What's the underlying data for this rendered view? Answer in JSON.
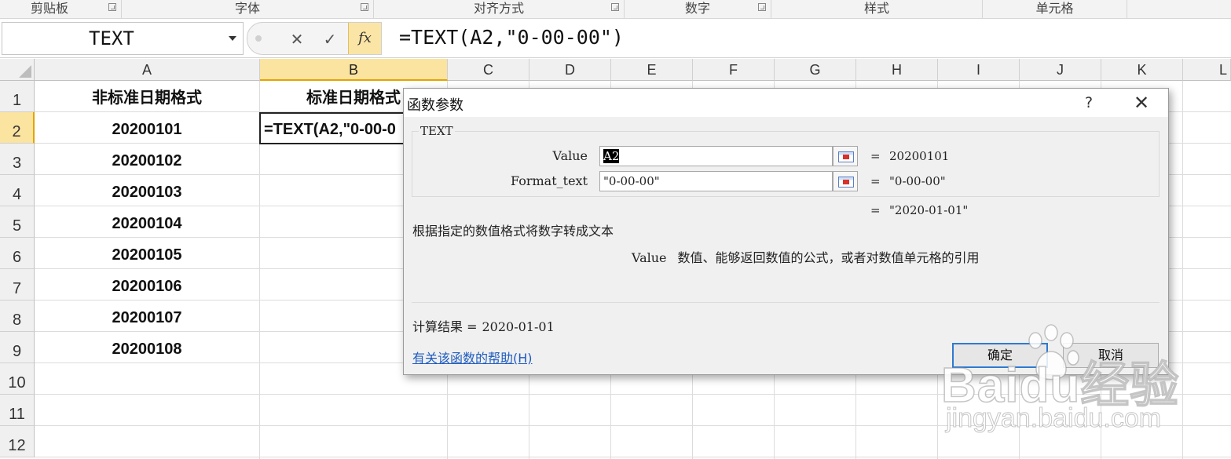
{
  "ribbon": {
    "groups": [
      "剪贴板",
      "字体",
      "对齐方式",
      "数字",
      "样式",
      "单元格"
    ]
  },
  "formula_bar": {
    "name_box": "TEXT",
    "formula": "=TEXT(A2,\"0-00-00\")"
  },
  "sheet": {
    "columns": [
      "A",
      "B",
      "C",
      "D",
      "E",
      "F",
      "G",
      "H",
      "I",
      "J",
      "K",
      "L"
    ],
    "rows": [
      "1",
      "2",
      "3",
      "4",
      "5",
      "6",
      "7",
      "8",
      "9",
      "10",
      "11",
      "12"
    ],
    "a1": "非标准日期格式",
    "b1": "标准日期格式",
    "column_a_values": [
      "20200101",
      "20200102",
      "20200103",
      "20200104",
      "20200105",
      "20200106",
      "20200107",
      "20200108"
    ],
    "b2_edit": "=TEXT(A2,\"0-00-0"
  },
  "dialog": {
    "title": "函数参数",
    "help": "?",
    "close": "✕",
    "func_name": "TEXT",
    "args": [
      {
        "label": "Value",
        "input": "A2",
        "eq": "=",
        "result": "20200101"
      },
      {
        "label": "Format_text",
        "input": "\"0-00-00\"",
        "eq": "=",
        "result": "\"0-00-00\""
      }
    ],
    "overall_eq": "=",
    "overall_result": "\"2020-01-01\"",
    "description": "根据指定的数值格式将数字转成文本",
    "param_name": "Value",
    "param_desc": "数值、能够返回数值的公式，或者对数值单元格的引用",
    "result_label": "计算结果 =",
    "result_value": "2020-01-01",
    "help_link": "有关该函数的帮助(H)",
    "ok": "确定",
    "cancel": "取消"
  },
  "watermark": {
    "brand": "Baidu经验",
    "url": "jingyan.baidu.com"
  }
}
